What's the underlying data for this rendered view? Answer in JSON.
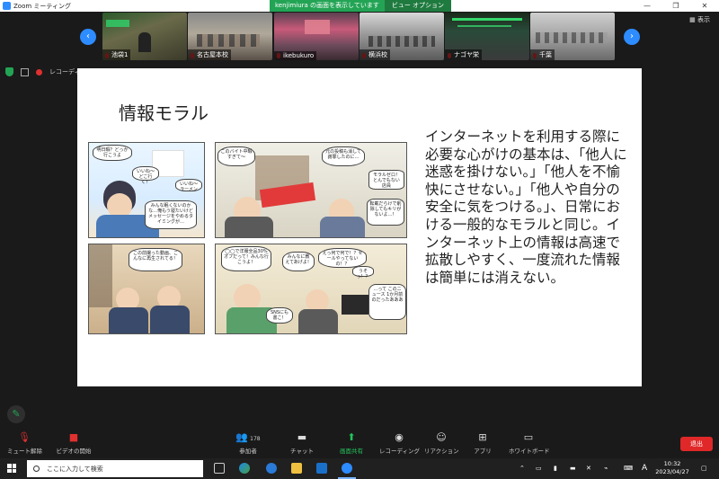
{
  "window": {
    "title": "Zoom ミーティング"
  },
  "share_banner": {
    "sharer_text": "kenjimiura の画面を表示しています",
    "view_options": "ビュー オプション"
  },
  "window_controls": {
    "minimize": "—",
    "restore": "❐",
    "close": "✕"
  },
  "video_strip": {
    "show_label": "表示",
    "participants": [
      {
        "name": "池袋1"
      },
      {
        "name": "名古屋本校"
      },
      {
        "name": "ikebukuro"
      },
      {
        "name": "横浜校"
      },
      {
        "name": "ナゴヤ栄"
      },
      {
        "name": "千葉"
      }
    ]
  },
  "indicators": {
    "recording_label": "レコーディ"
  },
  "slide": {
    "title": "情報モラル",
    "body": "インターネットを利用する際に必要な心がけの基本は、「他人に迷惑を掛けない。」「他人を不愉快にさせない。」「他人や自分の安全に気をつける。」、日常における一般的なモラルと同じ。インターネット上の情報は高速で拡散しやすく、一度流れた情報は簡単には消えない。",
    "manga_bubbles": [
      "明日暇？どっか行こうよ",
      "いいね～どこ行く？",
      "いいね～ラーメン",
      "みんな眠くないのかな…俺もう寝たいけどメッセージをやめるタイミングが…",
      "このバイト中暇すぎて～",
      "元の投稿も消して謝罪したのに…",
      "モラルゼロ！とんでもない店員",
      "転載だらけで削除してもキリがないよ…！",
      "この前撮った動画、こんなに再生されてる！",
      "◯◯で洋服全品30%オフだって！みんな行こうよ！",
      "みんなに教えてあげよ！",
      "えっ何で何で！？セールやってないの！？",
      "…って このニュース 1か月前のだったあああ",
      "SNSにも書こ！",
      "うそっ！？"
    ]
  },
  "toolbar": {
    "mute": "ミュート解除",
    "video": "ビデオの開始",
    "participants": "参加者",
    "participant_count": "178",
    "chat": "チャット",
    "share": "画面共有",
    "record": "レコーディング",
    "reactions": "リアクション",
    "apps": "アプリ",
    "whiteboard": "ホワイトボード",
    "end": "退出"
  },
  "taskbar": {
    "search_placeholder": "ここに入力して検索",
    "time": "10:32",
    "date": "2023/04/27",
    "ime": "A"
  },
  "colors": {
    "zoom_blue": "#2d8cff",
    "share_green": "#23a455",
    "end_red": "#e02828"
  }
}
